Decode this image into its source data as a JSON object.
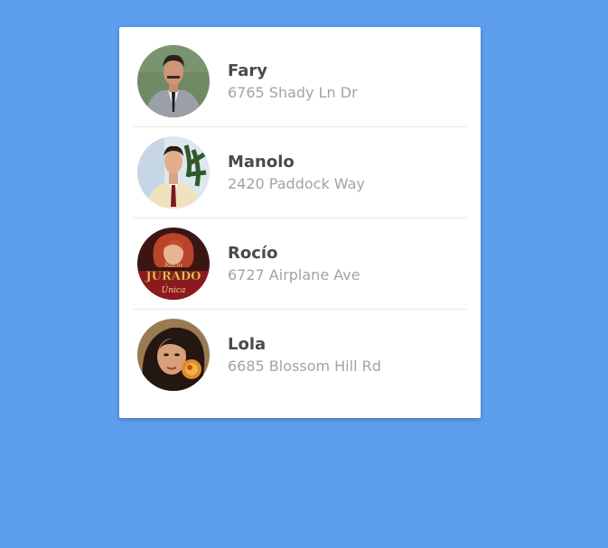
{
  "contacts": [
    {
      "name": "Fary",
      "address": "6765 Shady Ln Dr",
      "avatar_icon": "portrait-man-grey-suit-avatar"
    },
    {
      "name": "Manolo",
      "address": "2420 Paddock Way",
      "avatar_icon": "portrait-man-cream-suit-avatar"
    },
    {
      "name": "Rocío",
      "address": "6727 Airplane Ave",
      "avatar_icon": "album-cover-rocio-jurado-avatar"
    },
    {
      "name": "Lola",
      "address": "6685 Blossom Hill Rd",
      "avatar_icon": "portrait-woman-dark-hair-avatar"
    }
  ],
  "album_cover_text": [
    "Rocio",
    "JURADO",
    "Única"
  ],
  "colors": {
    "background": "#5d9eef",
    "card": "#ffffff",
    "name_text": "#4a4a4a",
    "address_text": "#a3a3a3",
    "divider": "#e9e9e9"
  }
}
